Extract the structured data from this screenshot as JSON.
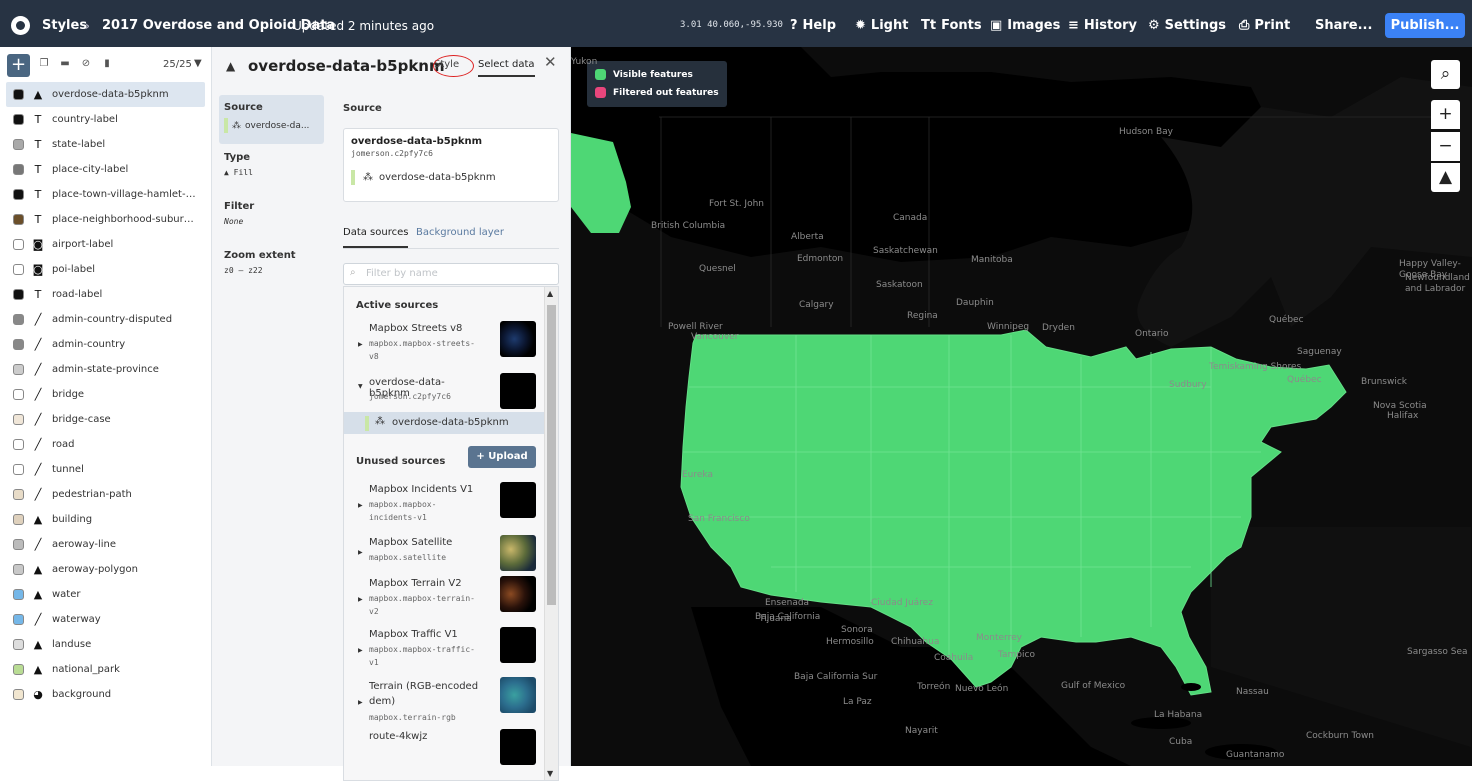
{
  "topbar": {
    "styles_label": "Styles",
    "style_name": "2017 Overdose and Opioid Data",
    "updated": "Updated 2 minutes ago",
    "coords": "3.01 40.060,-95.930",
    "help": "Help",
    "light": "Light",
    "fonts": "Fonts",
    "images": "Images",
    "history": "History",
    "settings": "Settings",
    "print": "Print",
    "share": "Share...",
    "publish": "Publish..."
  },
  "layers_panel": {
    "count": "25/25",
    "items": [
      {
        "name": "overdose-data-b5pknm",
        "type": "fill",
        "color": "#111111"
      },
      {
        "name": "country-label",
        "type": "symbol",
        "color": "#111111"
      },
      {
        "name": "state-label",
        "type": "symbol",
        "color": "#a9a9a9"
      },
      {
        "name": "place-city-label",
        "type": "symbol",
        "color": "#777777"
      },
      {
        "name": "place-town-village-hamlet-label",
        "type": "symbol",
        "color": "#111111"
      },
      {
        "name": "place-neighborhood-suburb-l...",
        "type": "symbol",
        "color": "#6b4f2a"
      },
      {
        "name": "airport-label",
        "type": "icon",
        "color": "#ffffff"
      },
      {
        "name": "poi-label",
        "type": "icon",
        "color": "#ffffff"
      },
      {
        "name": "road-label",
        "type": "symbol",
        "color": "#111111"
      },
      {
        "name": "admin-country-disputed",
        "type": "line",
        "color": "#888888"
      },
      {
        "name": "admin-country",
        "type": "line",
        "color": "#888888"
      },
      {
        "name": "admin-state-province",
        "type": "line",
        "color": "#cccccc"
      },
      {
        "name": "bridge",
        "type": "line",
        "color": "#ffffff"
      },
      {
        "name": "bridge-case",
        "type": "line",
        "color": "#f0e6d8"
      },
      {
        "name": "road",
        "type": "line",
        "color": "#ffffff"
      },
      {
        "name": "tunnel",
        "type": "line",
        "color": "#ffffff"
      },
      {
        "name": "pedestrian-path",
        "type": "line",
        "color": "#e8dcc8"
      },
      {
        "name": "building",
        "type": "fill",
        "color": "#dfd1bd"
      },
      {
        "name": "aeroway-line",
        "type": "line",
        "color": "#bbbbbb"
      },
      {
        "name": "aeroway-polygon",
        "type": "fill",
        "color": "#c8c8c8"
      },
      {
        "name": "water",
        "type": "fill",
        "color": "#75b7e8"
      },
      {
        "name": "waterway",
        "type": "line",
        "color": "#75b7e8"
      },
      {
        "name": "landuse",
        "type": "fill",
        "color": "#dddddd"
      },
      {
        "name": "national_park",
        "type": "fill",
        "color": "#b9dc94"
      },
      {
        "name": "background",
        "type": "background",
        "color": "#f1e6d0"
      }
    ]
  },
  "editor": {
    "layer_title": "overdose-data-b5pknm",
    "tab_style": "Style",
    "tab_select": "Select data",
    "props": {
      "source_label": "Source",
      "source_value": "overdose-da...",
      "type_label": "Type",
      "type_value": "Fill",
      "filter_label": "Filter",
      "filter_value": "None",
      "zoom_label": "Zoom extent",
      "zoom_value": "z0 – z22"
    },
    "source_heading": "Source",
    "source_box": {
      "name": "overdose-data-b5pknm",
      "id": "jomerson.c2pfy7c6",
      "layer": "overdose-data-b5pknm"
    },
    "subtab_data": "Data sources",
    "subtab_background": "Background layer",
    "filter_placeholder": "Filter by name",
    "active_heading": "Active sources",
    "unused_heading": "Unused sources",
    "upload_label": "Upload",
    "active_sources": [
      {
        "name": "Mapbox Streets v8",
        "id": "mapbox.mapbox-streets-v8"
      },
      {
        "name": "overdose-data-b5pknm",
        "id": "jomerson.c2pfy7c6",
        "layer": "overdose-data-b5pknm"
      }
    ],
    "unused_sources": [
      {
        "name": "Mapbox Incidents V1",
        "id": "mapbox.mapbox-incidents-v1"
      },
      {
        "name": "Mapbox Satellite",
        "id": "mapbox.satellite"
      },
      {
        "name": "Mapbox Terrain V2",
        "id": "mapbox.mapbox-terrain-v2"
      },
      {
        "name": "Mapbox Traffic V1",
        "id": "mapbox.mapbox-traffic-v1"
      },
      {
        "name": "Terrain (RGB-encoded dem)",
        "id": "mapbox.terrain-rgb"
      },
      {
        "name": "route-4kwjz",
        "id": ""
      }
    ]
  },
  "map": {
    "legend_visible": "Visible features",
    "legend_filtered": "Filtered out features",
    "visible_color": "#4ed775",
    "filtered_color": "#e8467c",
    "labels": [
      "Hudson Bay",
      "Yukon",
      "Fort St. John",
      "Canada",
      "British Columbia",
      "Alberta",
      "Edmonton",
      "Saskatchewan",
      "Manitoba",
      "Quesnel",
      "Saskatoon",
      "Calgary",
      "Regina",
      "Dauphin",
      "Winnipeg",
      "Dryden",
      "Powell River",
      "Vancouver",
      "Ontario",
      "Québec",
      "Saguenay",
      "Temiskaming Shores",
      "Sudbury",
      "Québec",
      "Brunswick",
      "Nova Scotia",
      "Halifax",
      "Happy Valley-Goose Bay",
      "Newfoundland and Labrador",
      "Sargasso Sea",
      "Gulf of Mexico",
      "San Francisco",
      "Eureka",
      "Tijuana",
      "Ensenada",
      "Baja California",
      "Sonora",
      "Hermosillo",
      "Chihuahua",
      "Coahuila",
      "Baja California Sur",
      "La Paz",
      "Torreón",
      "Nuevo León",
      "Nayarit",
      "La Habana",
      "Cuba",
      "Cockburn Town",
      "Nassau",
      "Guantanamo",
      "Ciudad Juárez",
      "Monterrey",
      "Tampico"
    ]
  }
}
